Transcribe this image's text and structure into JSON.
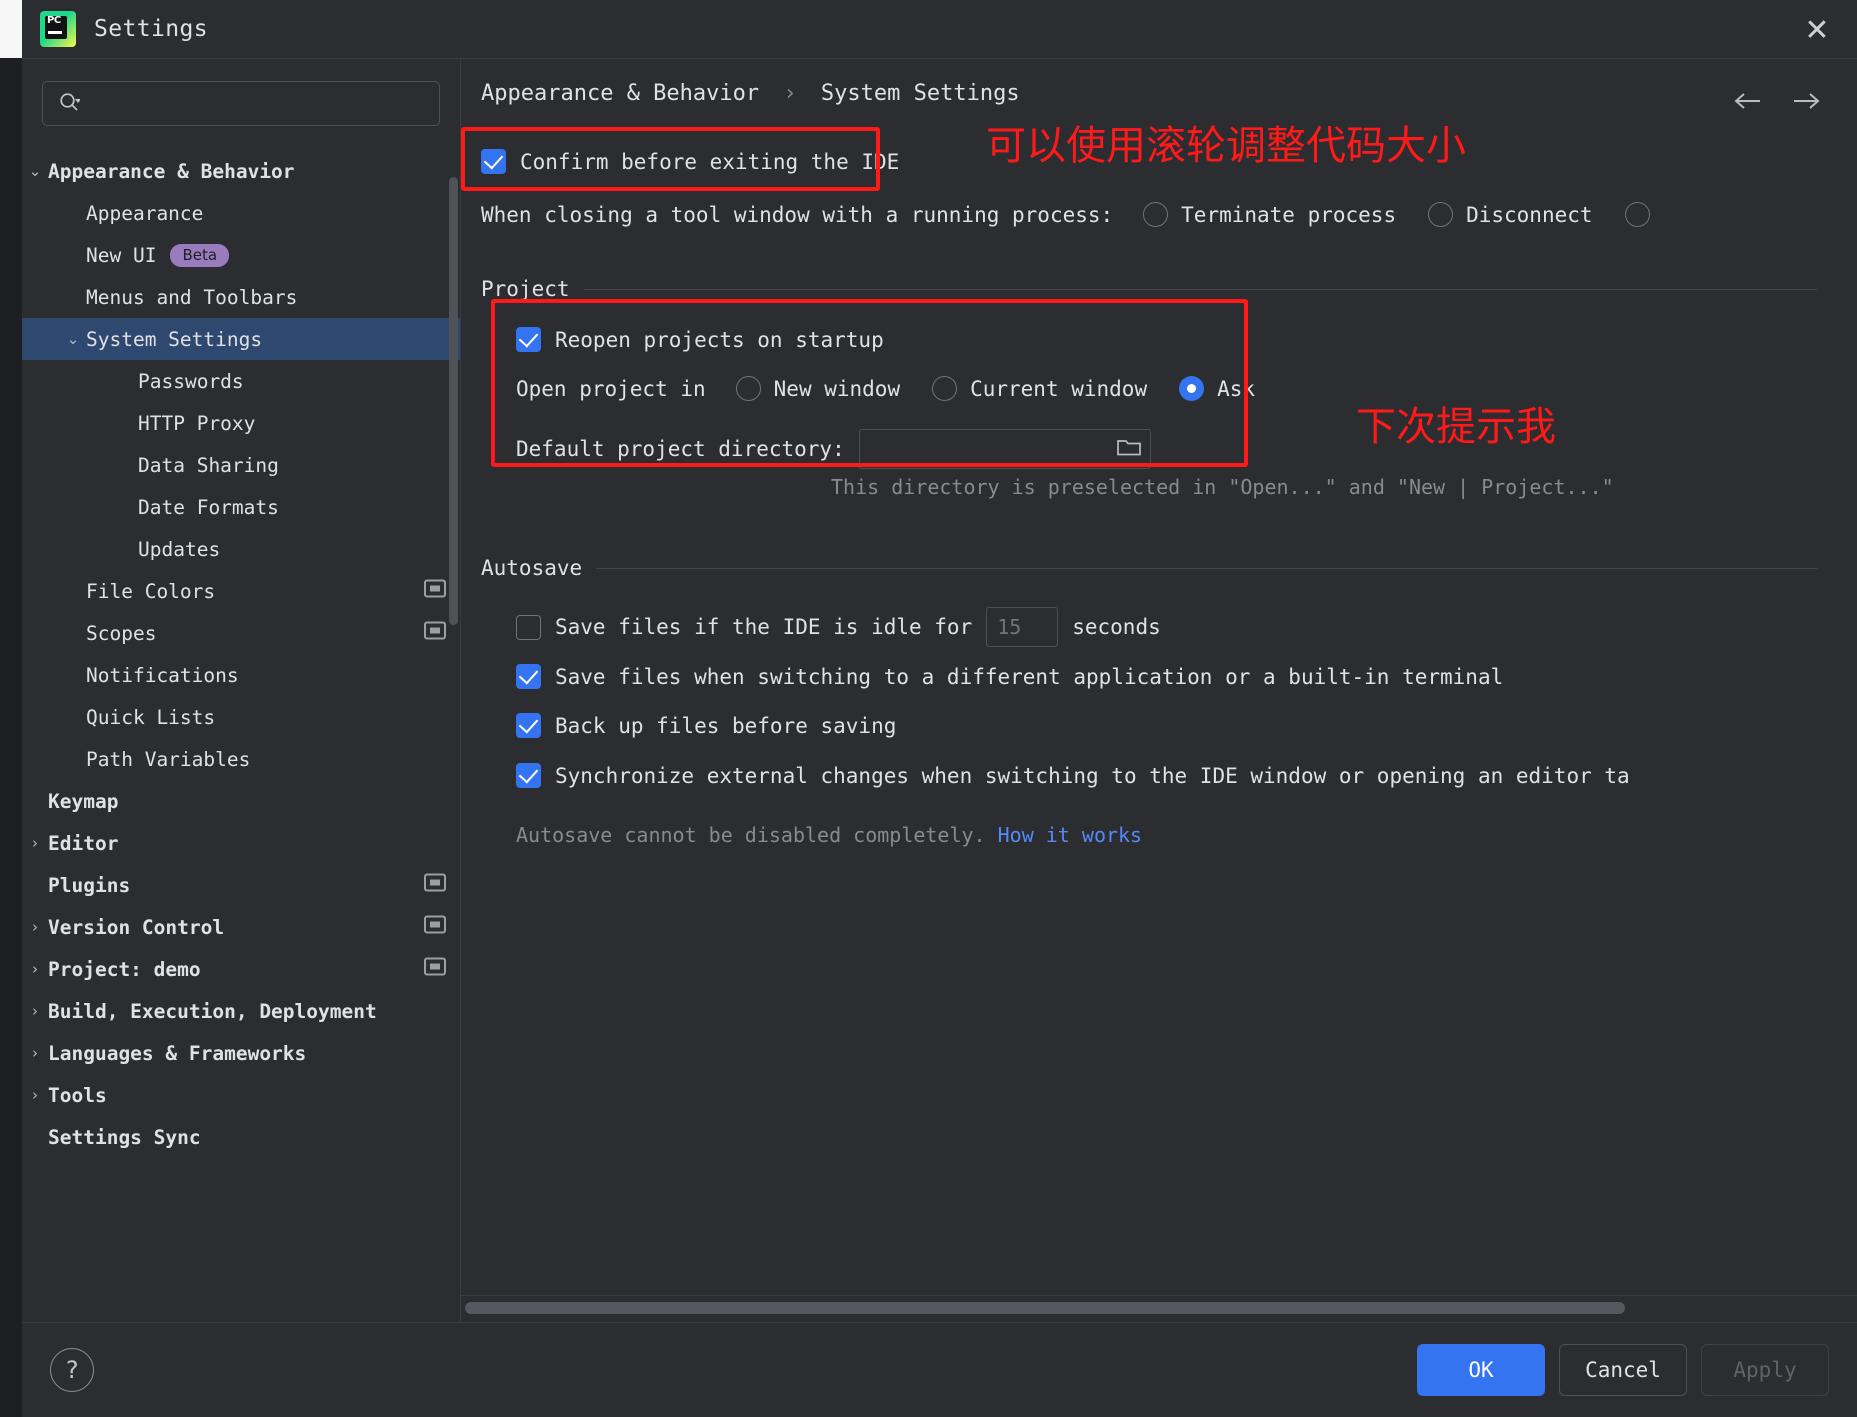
{
  "window": {
    "title": "Settings",
    "app_icon": "pycharm-logo",
    "close_label": "✕"
  },
  "search": {
    "value": "",
    "placeholder": "",
    "icon": "search-icon"
  },
  "sidebar": {
    "items": [
      {
        "label": "Appearance & Behavior",
        "level": 0,
        "arrow": "⌄",
        "bold": true,
        "selected": false,
        "badge": null,
        "screen_icon": false
      },
      {
        "label": "Appearance",
        "level": 1,
        "arrow": "",
        "bold": false,
        "selected": false,
        "badge": null,
        "screen_icon": false
      },
      {
        "label": "New UI",
        "level": 1,
        "arrow": "",
        "bold": false,
        "selected": false,
        "badge": "Beta",
        "screen_icon": false
      },
      {
        "label": "Menus and Toolbars",
        "level": 1,
        "arrow": "",
        "bold": false,
        "selected": false,
        "badge": null,
        "screen_icon": false
      },
      {
        "label": "System Settings",
        "level": 1,
        "arrow": "⌄",
        "bold": false,
        "selected": true,
        "badge": null,
        "screen_icon": false
      },
      {
        "label": "Passwords",
        "level": 2,
        "arrow": "",
        "bold": false,
        "selected": false,
        "badge": null,
        "screen_icon": false
      },
      {
        "label": "HTTP Proxy",
        "level": 2,
        "arrow": "",
        "bold": false,
        "selected": false,
        "badge": null,
        "screen_icon": false
      },
      {
        "label": "Data Sharing",
        "level": 2,
        "arrow": "",
        "bold": false,
        "selected": false,
        "badge": null,
        "screen_icon": false
      },
      {
        "label": "Date Formats",
        "level": 2,
        "arrow": "",
        "bold": false,
        "selected": false,
        "badge": null,
        "screen_icon": false
      },
      {
        "label": "Updates",
        "level": 2,
        "arrow": "",
        "bold": false,
        "selected": false,
        "badge": null,
        "screen_icon": false
      },
      {
        "label": "File Colors",
        "level": 1,
        "arrow": "",
        "bold": false,
        "selected": false,
        "badge": null,
        "screen_icon": true
      },
      {
        "label": "Scopes",
        "level": 1,
        "arrow": "",
        "bold": false,
        "selected": false,
        "badge": null,
        "screen_icon": true
      },
      {
        "label": "Notifications",
        "level": 1,
        "arrow": "",
        "bold": false,
        "selected": false,
        "badge": null,
        "screen_icon": false
      },
      {
        "label": "Quick Lists",
        "level": 1,
        "arrow": "",
        "bold": false,
        "selected": false,
        "badge": null,
        "screen_icon": false
      },
      {
        "label": "Path Variables",
        "level": 1,
        "arrow": "",
        "bold": false,
        "selected": false,
        "badge": null,
        "screen_icon": false
      },
      {
        "label": "Keymap",
        "level": 0,
        "arrow": "",
        "bold": true,
        "selected": false,
        "badge": null,
        "screen_icon": false
      },
      {
        "label": "Editor",
        "level": 0,
        "arrow": "›",
        "bold": true,
        "selected": false,
        "badge": null,
        "screen_icon": false
      },
      {
        "label": "Plugins",
        "level": 0,
        "arrow": "",
        "bold": true,
        "selected": false,
        "badge": null,
        "screen_icon": true
      },
      {
        "label": "Version Control",
        "level": 0,
        "arrow": "›",
        "bold": true,
        "selected": false,
        "badge": null,
        "screen_icon": true
      },
      {
        "label": "Project: demo",
        "level": 0,
        "arrow": "›",
        "bold": true,
        "selected": false,
        "badge": null,
        "screen_icon": true
      },
      {
        "label": "Build, Execution, Deployment",
        "level": 0,
        "arrow": "›",
        "bold": true,
        "selected": false,
        "badge": null,
        "screen_icon": false
      },
      {
        "label": "Languages & Frameworks",
        "level": 0,
        "arrow": "›",
        "bold": true,
        "selected": false,
        "badge": null,
        "screen_icon": false
      },
      {
        "label": "Tools",
        "level": 0,
        "arrow": "›",
        "bold": true,
        "selected": false,
        "badge": null,
        "screen_icon": false
      },
      {
        "label": "Settings Sync",
        "level": 0,
        "arrow": "",
        "bold": true,
        "selected": false,
        "badge": null,
        "screen_icon": false
      }
    ]
  },
  "breadcrumb": {
    "parent": "Appearance & Behavior",
    "separator": "›",
    "current": "System Settings"
  },
  "nav": {
    "back_icon": "arrow-left-icon",
    "forward_icon": "arrow-right-icon",
    "back_glyph": "←",
    "forward_glyph": "→"
  },
  "main": {
    "confirm_exit": {
      "label": "Confirm before exiting the IDE",
      "checked": true
    },
    "tool_window": {
      "label": "When closing a tool window with a running process:",
      "options": [
        {
          "label": "Terminate process",
          "selected": false
        },
        {
          "label": "Disconnect",
          "selected": false
        }
      ]
    },
    "project_section": {
      "title": "Project",
      "reopen": {
        "label": "Reopen projects on startup",
        "checked": true
      },
      "open_in_label": "Open project in",
      "open_in_options": [
        {
          "label": "New window",
          "selected": false
        },
        {
          "label": "Current window",
          "selected": false
        },
        {
          "label": "Ask",
          "selected": true
        }
      ],
      "default_dir_label": "Default project directory:",
      "default_dir_value": "",
      "browse_icon": "folder-icon",
      "hint": "This directory is preselected in \"Open...\" and \"New | Project...\""
    },
    "autosave_section": {
      "title": "Autosave",
      "idle": {
        "label_before": "Save files if the IDE is idle for",
        "value": "15",
        "label_after": "seconds",
        "checked": false
      },
      "items": [
        {
          "label": "Save files when switching to a different application or a built-in terminal",
          "checked": true
        },
        {
          "label": "Back up files before saving",
          "checked": true
        },
        {
          "label": "Synchronize external changes when switching to the IDE window or opening an editor ta",
          "checked": true
        }
      ],
      "footnote": "Autosave cannot be disabled completely.",
      "footnote_link": "How it works"
    }
  },
  "annotations": {
    "note_top": "可以使用滚轮调整代码大小",
    "note_right": "下次提示我",
    "color": "#ff1a1a"
  },
  "footer": {
    "help_glyph": "?",
    "ok": "OK",
    "cancel": "Cancel",
    "apply": "Apply"
  },
  "colors": {
    "accent": "#3574f0",
    "selection": "#2f4870",
    "background": "#2b2d30",
    "text": "#dfe1e5",
    "dim_text": "#868a91",
    "annotation_red": "#ff1a1a",
    "beta_badge": "#9a7bbd"
  }
}
